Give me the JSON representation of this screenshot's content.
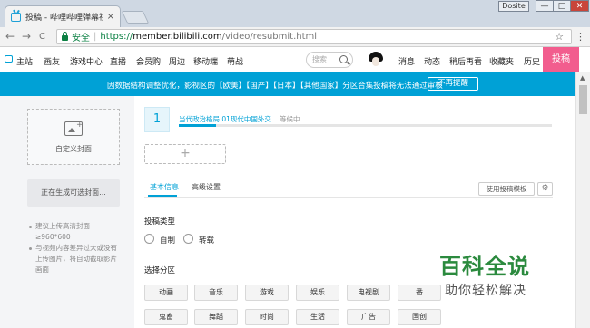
{
  "browser": {
    "tab_title": "投稿 - 哔哩哔哩弹幕视频",
    "tab_close": "×",
    "profile_badge": "Dosite",
    "window_controls": {
      "minimize": "—",
      "maximize": "□",
      "close": "✕"
    },
    "nav": {
      "back": "←",
      "forward": "→",
      "reload": "C"
    },
    "secure_label": "安全",
    "separator": "|",
    "url_scheme": "https://",
    "url_host": "member.bilibili.com",
    "url_path": "/video/resubmit.html",
    "star": "☆",
    "menu": "⋮"
  },
  "sitenav": {
    "items": [
      "主站",
      "画友",
      "游戏中心",
      "直播",
      "会员购",
      "周边",
      "移动端",
      "萌战"
    ],
    "search_placeholder": "搜索",
    "right_items": [
      "消息",
      "动态",
      "稍后再看",
      "收藏夹",
      "历史"
    ],
    "upload_label": "投稿"
  },
  "notice": {
    "text": "因数据结构调整优化，影视区的【欧美】【国产】【日本】【其他国家】分区合集投稿将无法通过审核",
    "button": "不再提醒"
  },
  "sidebar": {
    "cover_label": "自定义封面",
    "generating_text": "正在生成可选封面...",
    "tips": [
      "建议上传高清封面≥960*600",
      "与视频内容差异过大或没有上传图片，将自动截取影片画面"
    ]
  },
  "upload": {
    "index": "1",
    "video_title": "当代政治格局.01现代中国外交...",
    "status": "等候中",
    "progress": 0.1,
    "add_label": "+"
  },
  "tabs": {
    "basic": "基本信息",
    "advanced": "高级设置",
    "template_button": "使用投稿模板",
    "gear": "⚙"
  },
  "form": {
    "type_label": "投稿类型",
    "type_options": [
      "自制",
      "转载"
    ],
    "category_label": "选择分区",
    "categories_row1": [
      "动画",
      "音乐",
      "游戏",
      "娱乐",
      "电视剧",
      "番"
    ],
    "categories_row2": [
      "鬼畜",
      "舞蹈",
      "时尚",
      "生活",
      "广告",
      "国创"
    ]
  },
  "watermark": {
    "title": "百科全说",
    "subtitle": "助你轻松解决"
  },
  "colors": {
    "accent": "#00a1d6",
    "upload_pink": "#f25d8e",
    "watermark_green": "#2b8a3e"
  }
}
